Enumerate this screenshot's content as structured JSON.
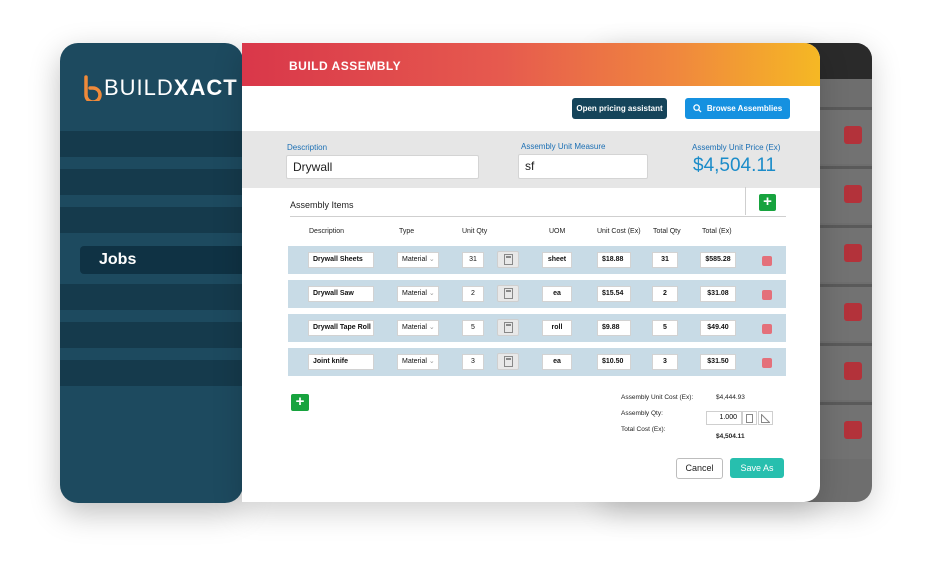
{
  "brand": {
    "name_light": "BUILD",
    "name_bold": "XACT"
  },
  "sidebar": {
    "active_item": "Jobs"
  },
  "header": {
    "title": "BUILD ASSEMBLY"
  },
  "toolbar": {
    "pricing_label": "Open pricing assistant",
    "browse_label": "Browse Assemblies"
  },
  "form": {
    "description_label": "Description",
    "description_value": "Drywall",
    "unit_measure_label": "Assembly Unit Measure",
    "unit_measure_value": "sf",
    "unit_price_label": "Assembly Unit Price (Ex)",
    "unit_price_value": "$4,504.11"
  },
  "items": {
    "title": "Assembly Items",
    "columns": [
      "Description",
      "Type",
      "Unit Qty",
      "UOM",
      "Unit Cost (Ex)",
      "Total Qty",
      "Total (Ex)"
    ],
    "rows": [
      {
        "description": "Drywall Sheets",
        "type": "Material",
        "unit_qty": "31",
        "uom": "sheet",
        "unit_cost": "$18.88",
        "total_qty": "31",
        "total": "$585.28"
      },
      {
        "description": "Drywall Saw",
        "type": "Material",
        "unit_qty": "2",
        "uom": "ea",
        "unit_cost": "$15.54",
        "total_qty": "2",
        "total": "$31.08"
      },
      {
        "description": "Drywall Tape Roll",
        "type": "Material",
        "unit_qty": "5",
        "uom": "roll",
        "unit_cost": "$9.88",
        "total_qty": "5",
        "total": "$49.40"
      },
      {
        "description": "Joint knife",
        "type": "Material",
        "unit_qty": "3",
        "uom": "ea",
        "unit_cost": "$10.50",
        "total_qty": "3",
        "total": "$31.50"
      }
    ]
  },
  "summary": {
    "unit_cost_label": "Assembly Unit Cost (Ex):",
    "unit_cost_value": "$4,444.93",
    "qty_label": "Assembly Qty:",
    "qty_value": "1.000",
    "total_label": "Total Cost (Ex):",
    "total_value": "$4,504.11"
  },
  "actions": {
    "cancel_label": "Cancel",
    "save_as_label": "Save As"
  },
  "colors": {
    "sidebar": "#1d4a5f",
    "primary_dark": "#15445a",
    "browse_blue": "#1591e0",
    "add_green": "#17a33e",
    "save_teal": "#27bfae",
    "price_blue": "#1b8cc9"
  }
}
